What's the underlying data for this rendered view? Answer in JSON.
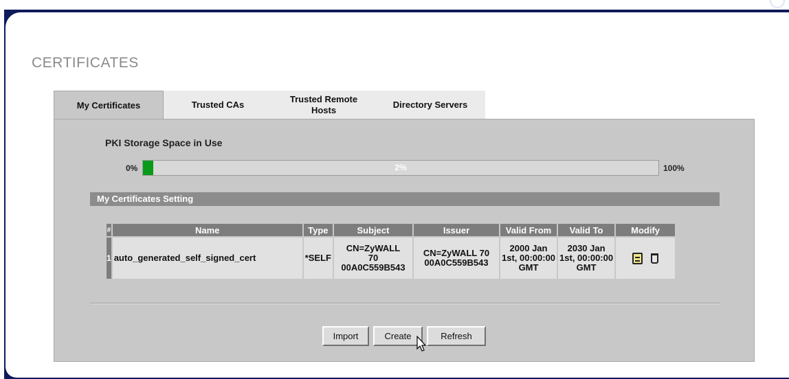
{
  "page": {
    "title": "CERTIFICATES"
  },
  "tabs": [
    {
      "label": "My Certificates",
      "active": true
    },
    {
      "label": "Trusted CAs",
      "active": false
    },
    {
      "label": "Trusted Remote\nHosts",
      "active": false
    },
    {
      "label": "Directory Servers",
      "active": false
    }
  ],
  "storage": {
    "title": "PKI Storage Space in Use",
    "min_label": "0%",
    "max_label": "100%",
    "usage_text": "2%",
    "usage_fraction": 0.02,
    "fill_color": "#0a9a1a"
  },
  "section": {
    "title": "My Certificates Setting"
  },
  "table": {
    "headers": {
      "index": "#",
      "name": "Name",
      "type": "Type",
      "subject": "Subject",
      "issuer": "Issuer",
      "valid_from": "Valid From",
      "valid_to": "Valid To",
      "modify": "Modify"
    },
    "rows": [
      {
        "index": "1",
        "name": "auto_generated_self_signed_cert",
        "type": "*SELF",
        "subject": "CN=ZyWALL\n70\n00A0C559B543",
        "issuer": "CN=ZyWALL 70\n00A0C559B543",
        "valid_from": "2000 Jan\n1st, 00:00:00\nGMT",
        "valid_to": "2030 Jan\n1st, 00:00:00\nGMT",
        "modify_icons": [
          "edit-icon",
          "trash-icon"
        ]
      }
    ]
  },
  "buttons": {
    "import": "Import",
    "create": "Create",
    "refresh": "Refresh"
  },
  "colors": {
    "frame": "#0f1a5c",
    "tab_active": "#c8c8c8",
    "header": "#7d7d7d"
  }
}
